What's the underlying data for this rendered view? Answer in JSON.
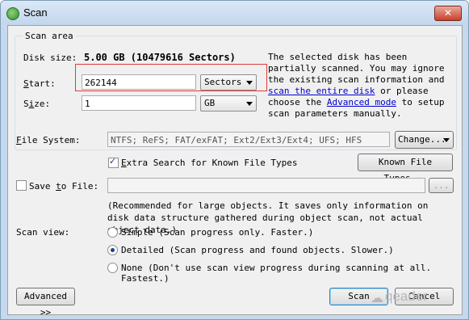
{
  "window": {
    "title": "Scan"
  },
  "scan_area": {
    "group_title": "Scan area",
    "disk_size_label": "Disk size:",
    "disk_size_value": "5.00 GB (10479616 Sectors)",
    "start_label": "Start:",
    "start_value": "262144",
    "start_unit": "Sectors",
    "size_label": "Size:",
    "size_value": "1",
    "size_unit": "GB",
    "info_part1": "The selected disk has been partially scanned. You may ignore the existing scan information and ",
    "info_link1": "scan the entire disk",
    "info_part2": " or please choose the ",
    "info_link2": "Advanced mode",
    "info_part3": " to setup scan parameters manually."
  },
  "file_system": {
    "label": "File System:",
    "value": "NTFS; ReFS; FAT/exFAT; Ext2/Ext3/Ext4; UFS; HFS",
    "change_button": "Change...",
    "extra_search_label": "Extra Search for Known File Types",
    "extra_search_checked": true,
    "known_file_types_button": "Known File Types..."
  },
  "save_to_file": {
    "label": "Save to File:",
    "checked": false,
    "browse_button": "...",
    "note": "(Recommended for large objects. It saves only information on disk data structure gathered during object scan, not actual object data.)"
  },
  "scan_view": {
    "label": "Scan view:",
    "options": [
      {
        "label": "Simple (Scan progress only. Faster.)",
        "selected": false
      },
      {
        "label": "Detailed (Scan progress and found objects. Slower.)",
        "selected": true
      },
      {
        "label": "None (Don't use scan view progress during scanning at all. Fastest.)",
        "selected": false
      }
    ]
  },
  "footer": {
    "advanced_button": "Advanced >>",
    "scan_button": "Scan",
    "cancel_button": "Cancel",
    "watermark": "qeader"
  },
  "icons": {
    "close": "close-icon",
    "dropdown": "chevron-down-icon"
  }
}
